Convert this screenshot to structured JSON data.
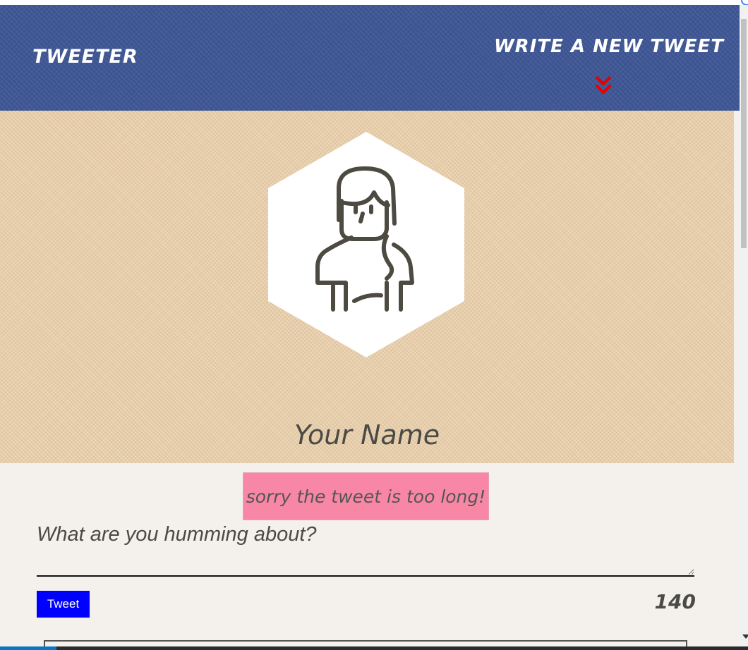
{
  "navbar": {
    "brand": "TWEETER",
    "compose_label": "WRITE A NEW TWEET",
    "chevron_color": "#e60000"
  },
  "profile": {
    "name": "Your Name",
    "avatar_icon": "woman-avatar-icon"
  },
  "error": {
    "message": "sorry the tweet is too long!"
  },
  "composer": {
    "placeholder": "What are you humming about?",
    "value": "",
    "button_label": "Tweet",
    "counter": "140"
  },
  "colors": {
    "navbar_bg": "#3f5796",
    "header_bg": "#ecd5b4",
    "page_bg": "#f4f1ec",
    "error_bg": "#f887a5",
    "button_bg": "#0000ff"
  }
}
